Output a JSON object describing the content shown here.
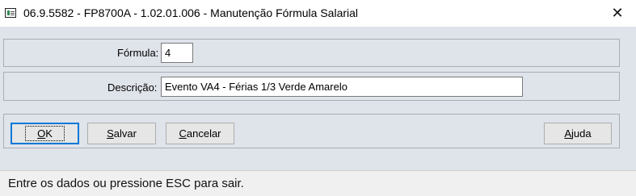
{
  "window": {
    "title": "06.9.5582 - FP8700A - 1.02.01.006 - Manutenção Fórmula Salarial",
    "close_glyph": "✕"
  },
  "form": {
    "formula_label": "Fórmula:",
    "formula_value": "4",
    "description_label": "Descrição:",
    "description_value": "Evento VA4 - Férias 1/3 Verde Amarelo"
  },
  "buttons": {
    "ok": {
      "accel": "O",
      "rest": "K"
    },
    "save": {
      "accel": "S",
      "rest": "alvar"
    },
    "cancel": {
      "accel": "C",
      "rest": "ancelar"
    },
    "help": {
      "accel": "A",
      "rest": "juda"
    }
  },
  "status": {
    "text": "Entre os dados ou pressione ESC para sair."
  },
  "colors": {
    "client_bg": "#dfe3ea",
    "default_button_border": "#0078d7"
  }
}
